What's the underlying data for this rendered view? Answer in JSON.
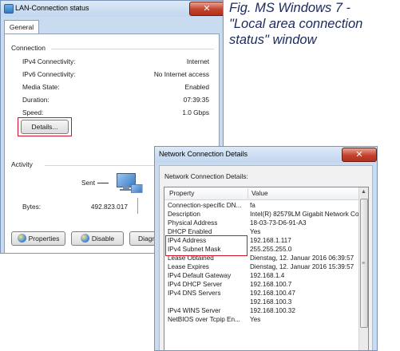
{
  "caption": {
    "line1": "Fig. MS Windows 7 -",
    "line2": "\"Local area connection",
    "line3": "status\" window"
  },
  "status_window": {
    "title": "LAN-Connection status",
    "tab": "General",
    "connection": {
      "label": "Connection",
      "rows": [
        {
          "label": "IPv4 Connectivity:",
          "value": "Internet"
        },
        {
          "label": "IPv6 Connectivity:",
          "value": "No Internet access"
        },
        {
          "label": "Media State:",
          "value": "Enabled"
        },
        {
          "label": "Duration:",
          "value": "07:39:35"
        },
        {
          "label": "Speed:",
          "value": "1.0 Gbps"
        }
      ],
      "details_button": "Details..."
    },
    "activity": {
      "label": "Activity",
      "sent_label": "Sent",
      "bytes_label": "Bytes:",
      "bytes_sent": "492.823.017"
    },
    "buttons": {
      "properties": "Properties",
      "disable": "Disable",
      "diagnose": "Diagnose"
    }
  },
  "details_window": {
    "title": "Network Connection Details",
    "heading": "Network Connection Details:",
    "columns": {
      "property": "Property",
      "value": "Value"
    },
    "rows": [
      {
        "property": "Connection-specific DN...",
        "value": "fa"
      },
      {
        "property": "Description",
        "value": "Intel(R) 82579LM Gigabit Network Con"
      },
      {
        "property": "Physical Address",
        "value": "18-03-73-D6-91-A3"
      },
      {
        "property": "DHCP Enabled",
        "value": "Yes"
      },
      {
        "property": "IPv4 Address",
        "value": "192.168.1.117"
      },
      {
        "property": "IPv4 Subnet Mask",
        "value": "255.255.255.0"
      },
      {
        "property": "Lease Obtained",
        "value": "Dienstag, 12. Januar 2016 06:39:57"
      },
      {
        "property": "Lease Expires",
        "value": "Dienstag, 12. Januar 2016 15:39:57"
      },
      {
        "property": "IPv4 Default Gateway",
        "value": "192.168.1.4"
      },
      {
        "property": "IPv4 DHCP Server",
        "value": "192.168.100.7"
      },
      {
        "property": "IPv4 DNS Servers",
        "value": "192.168.100.47"
      },
      {
        "property": "",
        "value": "192.168.100.3"
      },
      {
        "property": "IPv4 WINS Server",
        "value": "192.168.100.32"
      },
      {
        "property": "NetBIOS over Tcpip En...",
        "value": "Yes"
      }
    ]
  },
  "icons": {
    "titlebar": "network-connection-icon",
    "close": "close-icon",
    "computer": "computer-monitor-icon",
    "properties": "shield-icon",
    "disable": "shield-icon"
  },
  "colors": {
    "highlight_box": "#d0142b",
    "close_button": "#c2432d",
    "caption": "#1b2a5c"
  }
}
